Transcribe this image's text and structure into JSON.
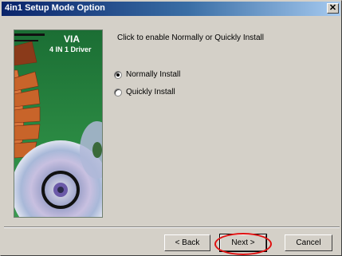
{
  "window": {
    "title": "4in1 Setup Mode Option",
    "close_label": "✕"
  },
  "banner": {
    "brand": "VIA",
    "product": "4 IN 1 Driver"
  },
  "instruction": "Click to enable Normally or Quickly Install",
  "options": [
    {
      "label": "Normally Install",
      "checked": true
    },
    {
      "label": "Quickly Install",
      "checked": false
    }
  ],
  "buttons": {
    "back": "< Back",
    "next": "Next >",
    "cancel": "Cancel"
  },
  "colors": {
    "highlight": "#e01010",
    "titlebar_start": "#0a246a",
    "banner_green": "#1e7a3a"
  }
}
